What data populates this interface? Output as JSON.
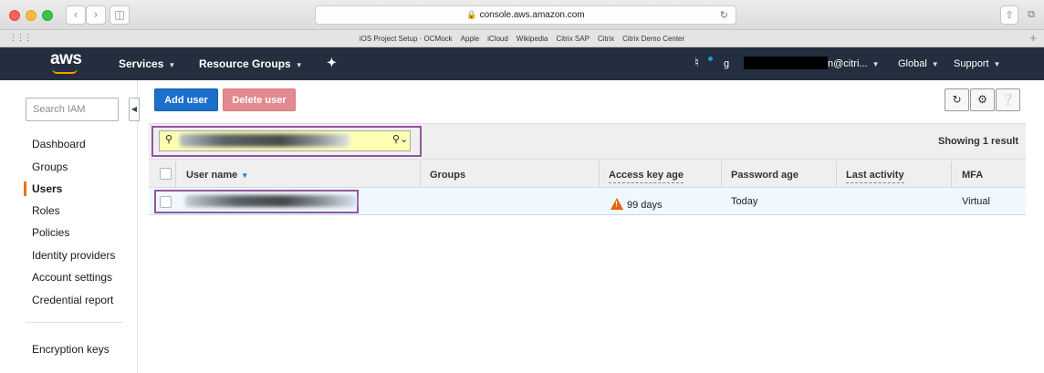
{
  "browser": {
    "url": "console.aws.amazon.com",
    "bookmarks": [
      "iOS Project Setup · OCMock",
      "Apple",
      "iCloud",
      "Wikipedia",
      "Citrix SAP",
      "Citrix",
      "Citrix Demo Center"
    ],
    "icons": {
      "back": "chevron-left-icon",
      "forward": "chevron-right-icon",
      "sidebar": "sidebar-icon",
      "reload": "reload-icon",
      "share": "share-icon",
      "tabs": "tabs-icon",
      "lock": "lock-icon"
    }
  },
  "aws_nav": {
    "logo": "aws",
    "services": "Services",
    "resource_groups": "Resource Groups",
    "account_prefix": "g",
    "account_suffix": "n@citri...",
    "region": "Global",
    "support": "Support",
    "colors": {
      "navbar": "#232f3e",
      "accent": "#ff9900"
    }
  },
  "sidebar": {
    "search_placeholder": "Search IAM",
    "items": [
      {
        "label": "Dashboard",
        "active": false
      },
      {
        "label": "Groups",
        "active": false
      },
      {
        "label": "Users",
        "active": true
      },
      {
        "label": "Roles",
        "active": false
      },
      {
        "label": "Policies",
        "active": false
      },
      {
        "label": "Identity providers",
        "active": false
      },
      {
        "label": "Account settings",
        "active": false
      },
      {
        "label": "Credential report",
        "active": false
      }
    ],
    "footer_items": [
      {
        "label": "Encryption keys"
      }
    ]
  },
  "toolbar": {
    "add_user": "Add user",
    "delete_user": "Delete user",
    "icons": [
      "refresh-icon",
      "gear-icon",
      "help-icon"
    ]
  },
  "filter": {
    "value": "",
    "showing": "Showing 1 result"
  },
  "table": {
    "columns": [
      "User name",
      "Groups",
      "Access key age",
      "Password age",
      "Last activity",
      "MFA"
    ],
    "rows": [
      {
        "user_name": "",
        "groups": "",
        "access_key_age": "99 days",
        "password_age": "Today",
        "last_activity": "",
        "mfa": "Virtual"
      }
    ]
  }
}
